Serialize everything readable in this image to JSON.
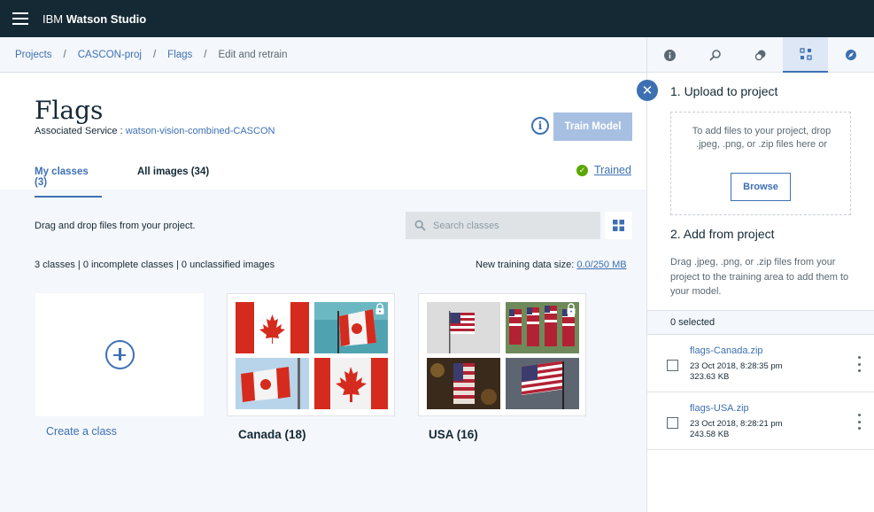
{
  "app": {
    "brand_prefix": "IBM ",
    "brand_name": "Watson Studio"
  },
  "breadcrumb": {
    "items": [
      "Projects",
      "CASCON-proj",
      "Flags"
    ],
    "current": "Edit and retrain"
  },
  "header": {
    "title": "Flags",
    "assoc_label": "Associated Service : ",
    "assoc_service": "watson-vision-combined-CASCON",
    "info_symbol": "i",
    "train_button": "Train Model",
    "tabs": [
      "My classes (3)",
      "All images (34)"
    ],
    "status": "Trained"
  },
  "content": {
    "drag_text": "Drag and drop files from your project.",
    "search_placeholder": "Search classes",
    "counts": "3 classes | 0 incomplete classes | 0 unclassified images",
    "data_size_label": "New training data size: ",
    "data_size_value": "0.0/250 MB",
    "create_label": "Create a class",
    "classes": [
      {
        "label": "Canada (18)"
      },
      {
        "label": "USA (16)"
      }
    ]
  },
  "panel": {
    "step1": "1. Upload to project",
    "dropzone_text": "To add files to your project, drop .jpeg, .png, or .zip files here or",
    "browse": "Browse",
    "step2": "2. Add from project",
    "step2_desc": "Drag .jpeg, .png, or .zip files from your project to the training area to add them to your model.",
    "selected": "0 selected",
    "files": [
      {
        "name": "flags-Canada.zip",
        "date": "23 Oct 2018, 8:28:35 pm",
        "size": "323.63 KB"
      },
      {
        "name": "flags-USA.zip",
        "date": "23 Oct 2018, 8:28:21 pm",
        "size": "243.58 KB"
      }
    ]
  },
  "colors": {
    "accent": "#3d70b2",
    "topbar": "#152935",
    "success": "#5aa700",
    "canada_red": "#d52b1e",
    "usa_red": "#b22234",
    "usa_blue": "#3c3b6e"
  }
}
